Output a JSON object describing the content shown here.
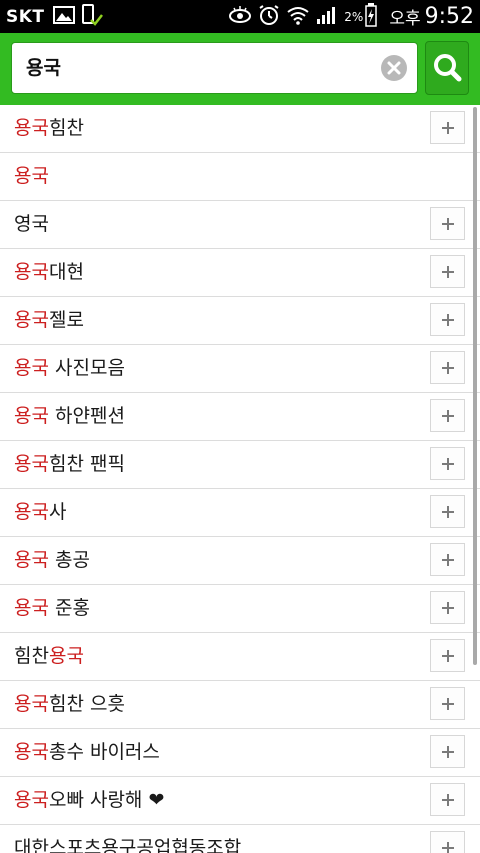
{
  "status_bar": {
    "carrier": "SKT",
    "battery_percent": "2%",
    "ampm": "오후",
    "time": "9:52"
  },
  "search": {
    "query": "용국"
  },
  "suggestions": [
    {
      "highlight": "용국",
      "rest": "힘찬",
      "has_add": true
    },
    {
      "highlight": "용국",
      "rest": "",
      "has_add": false
    },
    {
      "highlight": "",
      "rest": "영국",
      "has_add": true
    },
    {
      "highlight": "용국",
      "rest": "대현",
      "has_add": true
    },
    {
      "highlight": "용국",
      "rest": "젤로",
      "has_add": true
    },
    {
      "highlight": "용국",
      "rest": " 사진모음",
      "has_add": true
    },
    {
      "highlight": "용국",
      "rest": " 하얀펜션",
      "has_add": true
    },
    {
      "highlight": "용국",
      "rest": "힘찬 팬픽",
      "has_add": true
    },
    {
      "highlight": "용국",
      "rest": "사",
      "has_add": true
    },
    {
      "highlight": "용국",
      "rest": " 총공",
      "has_add": true
    },
    {
      "highlight": "용국",
      "rest": " 준홍",
      "has_add": true
    },
    {
      "prefix": "힘찬",
      "highlight": "용국",
      "rest": "",
      "has_add": true
    },
    {
      "highlight": "용국",
      "rest": "힘찬 으흣",
      "has_add": true
    },
    {
      "highlight": "용국",
      "rest": "총수 바이러스",
      "has_add": true
    },
    {
      "highlight": "용국",
      "rest": "오빠 사랑해 ❤",
      "has_add": true
    },
    {
      "highlight": "",
      "rest": "대한스포츠용구공업협동조합",
      "has_add": true
    }
  ]
}
